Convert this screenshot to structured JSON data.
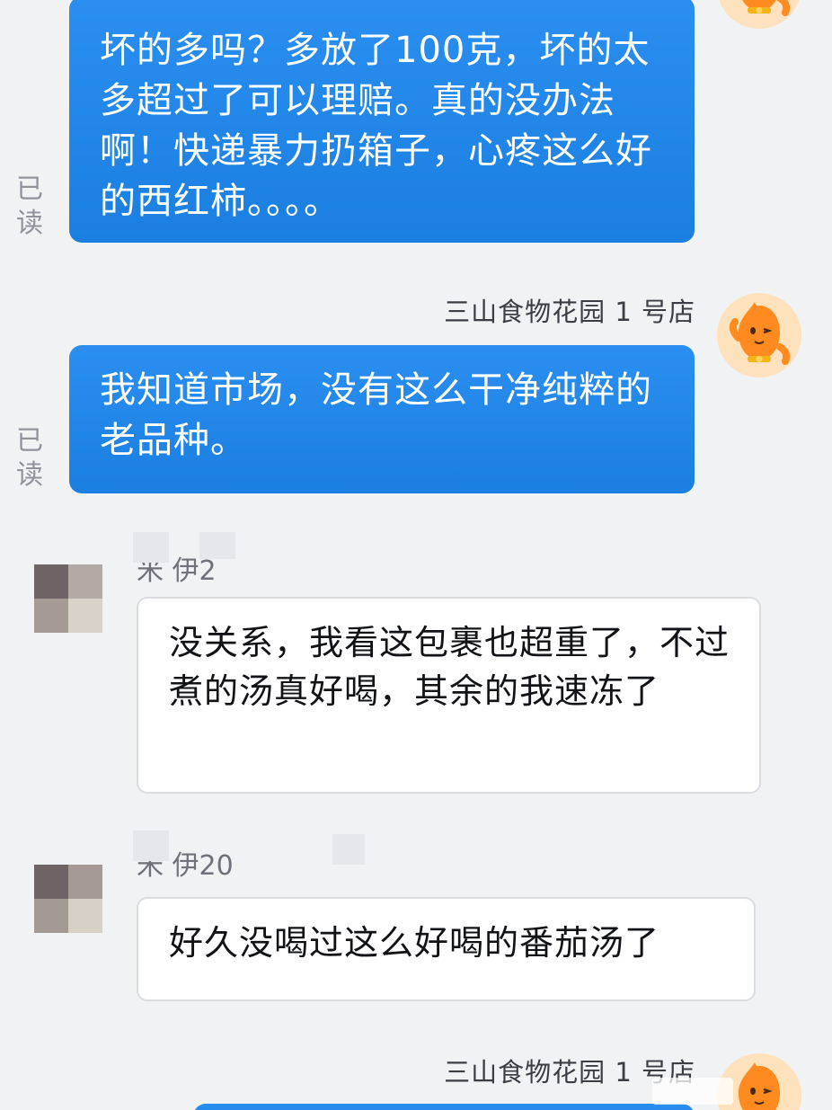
{
  "colors": {
    "outgoing_bubble": "#1a7fe0",
    "incoming_bubble": "#ffffff",
    "background": "#f1f2f4",
    "read_status": "#8f949c"
  },
  "messages": [
    {
      "direction": "outgoing",
      "text": "坏的多吗？多放了100克，坏的太多超过了可以理赔。真的没办法啊！快递暴力扔箱子，心疼这么好的西红柿。。。。",
      "status": "已读"
    },
    {
      "direction": "outgoing",
      "sender": "三山食物花园 1 号店",
      "text": "我知道市场，没有这么干净纯粹的老品种。",
      "status": "已读"
    },
    {
      "direction": "incoming",
      "sender": "米   伊2",
      "text": "没关系，我看这包裹也超重了，不过煮的汤真好喝，其余的我速冻了"
    },
    {
      "direction": "incoming",
      "sender": "米   伊20",
      "text": "好久没喝过这么好喝的番茄汤了"
    },
    {
      "direction": "outgoing",
      "sender": "三山食物花园 1 号店"
    }
  ]
}
